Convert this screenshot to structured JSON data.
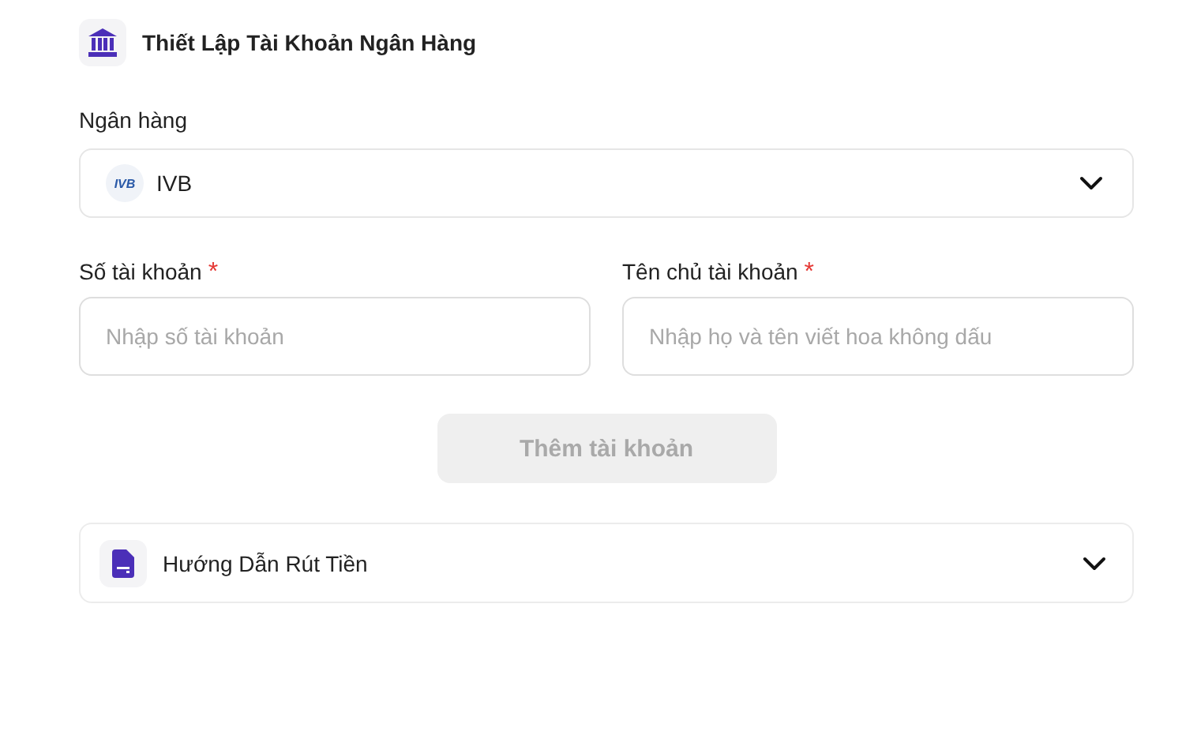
{
  "header": {
    "title": "Thiết Lập Tài Khoản Ngân Hàng"
  },
  "bank": {
    "label": "Ngân hàng",
    "logo_text": "IVB",
    "value": "IVB"
  },
  "fields": [
    {
      "label": "Số tài khoản",
      "required_mark": "*",
      "placeholder": "Nhập số tài khoản"
    },
    {
      "label": "Tên chủ tài khoản",
      "required_mark": "*",
      "placeholder": "Nhập họ và tên viết hoa không dấu"
    }
  ],
  "submit": {
    "label": "Thêm tài khoản",
    "disabled": true
  },
  "guide": {
    "title": "Hướng Dẫn Rút Tiền",
    "expanded": false
  }
}
